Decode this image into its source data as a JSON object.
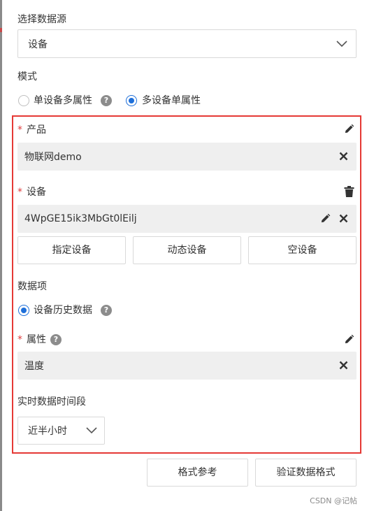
{
  "datasource": {
    "label": "选择数据源",
    "selected": "设备"
  },
  "mode": {
    "label": "模式",
    "options": [
      "单设备多属性",
      "多设备单属性"
    ],
    "selected_index": 1
  },
  "product": {
    "label": "产品",
    "required_mark": "*",
    "value": "物联网demo"
  },
  "device": {
    "label": "设备",
    "required_mark": "*",
    "value": "4WpGE15ik3MbGt0lEilj",
    "buttons": [
      "指定设备",
      "动态设备",
      "空设备"
    ]
  },
  "data_items": {
    "label": "数据项",
    "option": "设备历史数据",
    "selected": true
  },
  "attribute": {
    "label": "属性",
    "required_mark": "*",
    "value": "温度"
  },
  "realtime": {
    "label": "实时数据时间段",
    "selected": "近半小时"
  },
  "footer": {
    "format_ref": "格式参考",
    "validate": "验证数据格式"
  },
  "watermark": "CSDN @记帖",
  "colors": {
    "accent": "#1e6fd9",
    "required": "#e03b3b",
    "highlight_frame": "#e53935",
    "field_bg": "#efefef"
  },
  "icons": [
    "chevron-down-icon",
    "help-icon",
    "pencil-icon",
    "close-icon",
    "trash-icon"
  ]
}
